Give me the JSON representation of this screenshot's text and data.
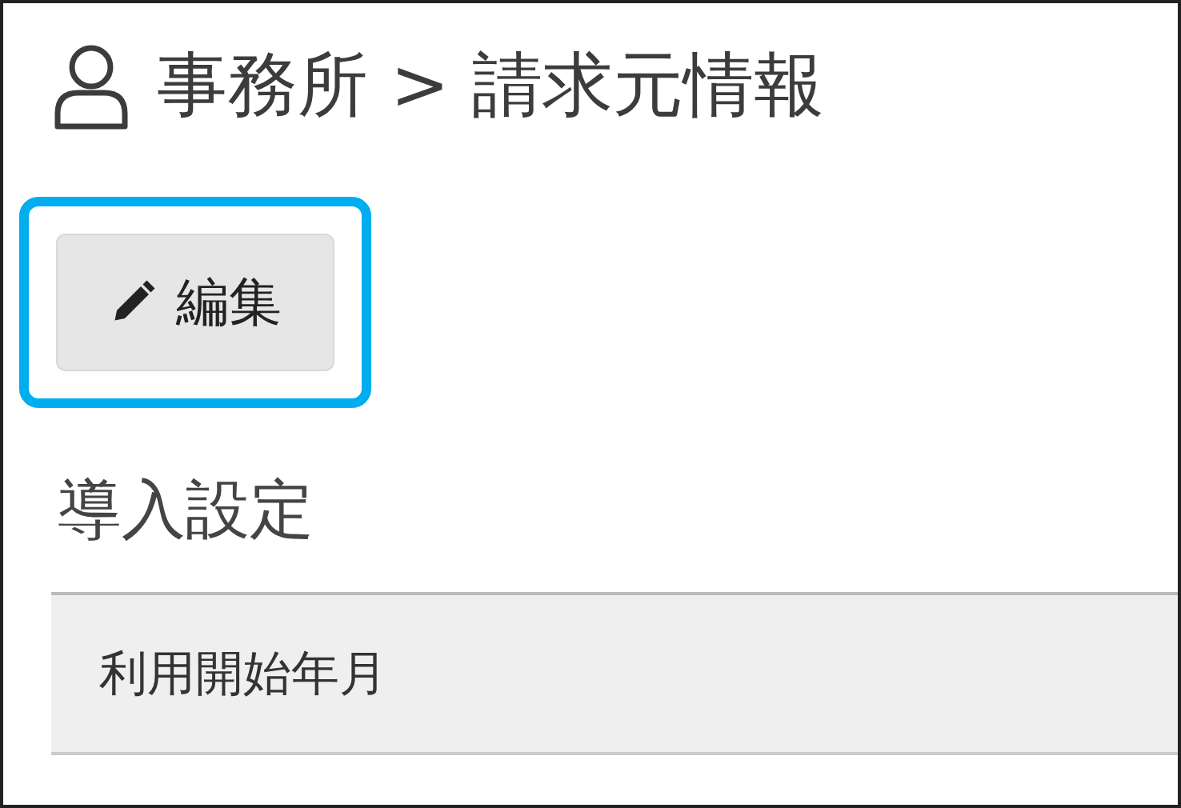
{
  "breadcrumb": "事務所 > 請求元情報",
  "edit_button": {
    "label": "編集",
    "highlighted": true
  },
  "section": {
    "title": "導入設定",
    "rows": [
      {
        "label": "利用開始年月"
      }
    ]
  }
}
